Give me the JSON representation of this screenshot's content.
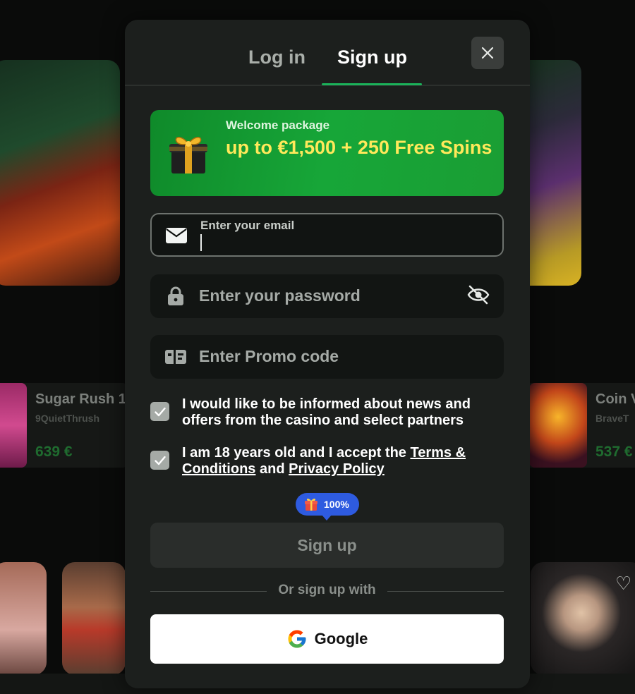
{
  "background": {
    "row_left": {
      "title": "Sugar Rush 1",
      "user": "9QuietThrush",
      "amount": "639 €"
    },
    "row_right": {
      "title": "Coin V",
      "user": "BraveT",
      "amount": "537 €"
    }
  },
  "tabs": {
    "login": "Log in",
    "signup": "Sign up",
    "active": "signup"
  },
  "promo": {
    "label": "Welcome package",
    "headline": "up to €1,500 + 250 Free Spins",
    "icon": "gift-box-icon"
  },
  "fields": {
    "email": {
      "label": "Enter your email",
      "value": "",
      "icon": "envelope-icon"
    },
    "password": {
      "placeholder": "Enter your password",
      "icon": "padlock-icon",
      "toggle_icon": "eye-slash-icon"
    },
    "promo": {
      "placeholder": "Enter Promo code",
      "icon": "ticket-icon"
    }
  },
  "consents": {
    "news": {
      "checked": true,
      "text": "I would like to be informed about news and offers from the casino and select partners"
    },
    "terms": {
      "checked": true,
      "prefix": "I am 18 years old and I accept the ",
      "terms_link": "Terms & Conditions",
      "middle": " and ",
      "privacy_link": "Privacy Policy"
    }
  },
  "bonus_badge": {
    "text": "100%"
  },
  "buttons": {
    "signup": "Sign up",
    "divider": "Or sign up with",
    "google": "Google"
  },
  "colors": {
    "accent": "#1bb25a",
    "promo_headline": "#ffe95a",
    "badge": "#2e5be0",
    "modal_bg": "#1c1f1d"
  }
}
